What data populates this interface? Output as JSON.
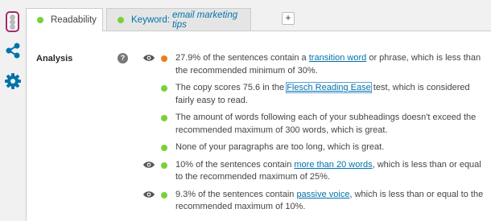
{
  "rail": {
    "icons": [
      "traffic-light-icon",
      "share-icon",
      "gear-icon"
    ]
  },
  "tabs": [
    {
      "label": "Readability",
      "status_color": "#7ad03a"
    },
    {
      "prefix": "Keyword:",
      "keyword": "email marketing tips",
      "status_color": "#7ad03a"
    }
  ],
  "add_tab_label": "+",
  "analysis": {
    "heading": "Analysis",
    "help_label": "?",
    "results": [
      {
        "status": "ok",
        "has_eye": true,
        "before": "27.9% of the sentences contain a ",
        "link": "transition word",
        "after": " or phrase, which is less than the recommended minimum of 30%."
      },
      {
        "status": "good",
        "has_eye": false,
        "before": "The copy scores 75.6 in the ",
        "link": "Flesch Reading Ease",
        "after": " test, which is considered fairly easy to read."
      },
      {
        "status": "good",
        "has_eye": false,
        "before": "The amount of words following each of your subheadings doesn't exceed the recommended maximum of 300 words, which is great.",
        "link": "",
        "after": ""
      },
      {
        "status": "good",
        "has_eye": false,
        "before": "None of your paragraphs are too long, which is great.",
        "link": "",
        "after": ""
      },
      {
        "status": "good",
        "has_eye": true,
        "before": "10% of the sentences contain ",
        "link": "more than 20 words",
        "after": ", which is less than or equal to the recommended maximum of 25%."
      },
      {
        "status": "good",
        "has_eye": true,
        "before": "9.3% of the sentences contain ",
        "link": "passive voice",
        "after": ", which is less than or equal to the recommended maximum of 10%."
      }
    ]
  },
  "colors": {
    "good": "#7ad03a",
    "ok": "#ee7c1b",
    "link": "#0073aa",
    "brand": "#a4286a",
    "icon_blue": "#0073aa"
  }
}
